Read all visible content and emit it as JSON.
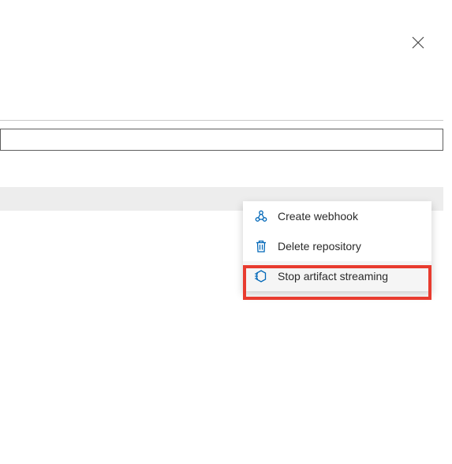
{
  "colors": {
    "icon_blue": "#0067b8",
    "highlight_red": "#e83b2f"
  },
  "context_menu": {
    "items": [
      {
        "label": "Create webhook",
        "icon": "webhook-icon"
      },
      {
        "label": "Delete repository",
        "icon": "trash-icon"
      },
      {
        "label": "Stop artifact streaming",
        "icon": "stop-streaming-icon"
      }
    ]
  }
}
